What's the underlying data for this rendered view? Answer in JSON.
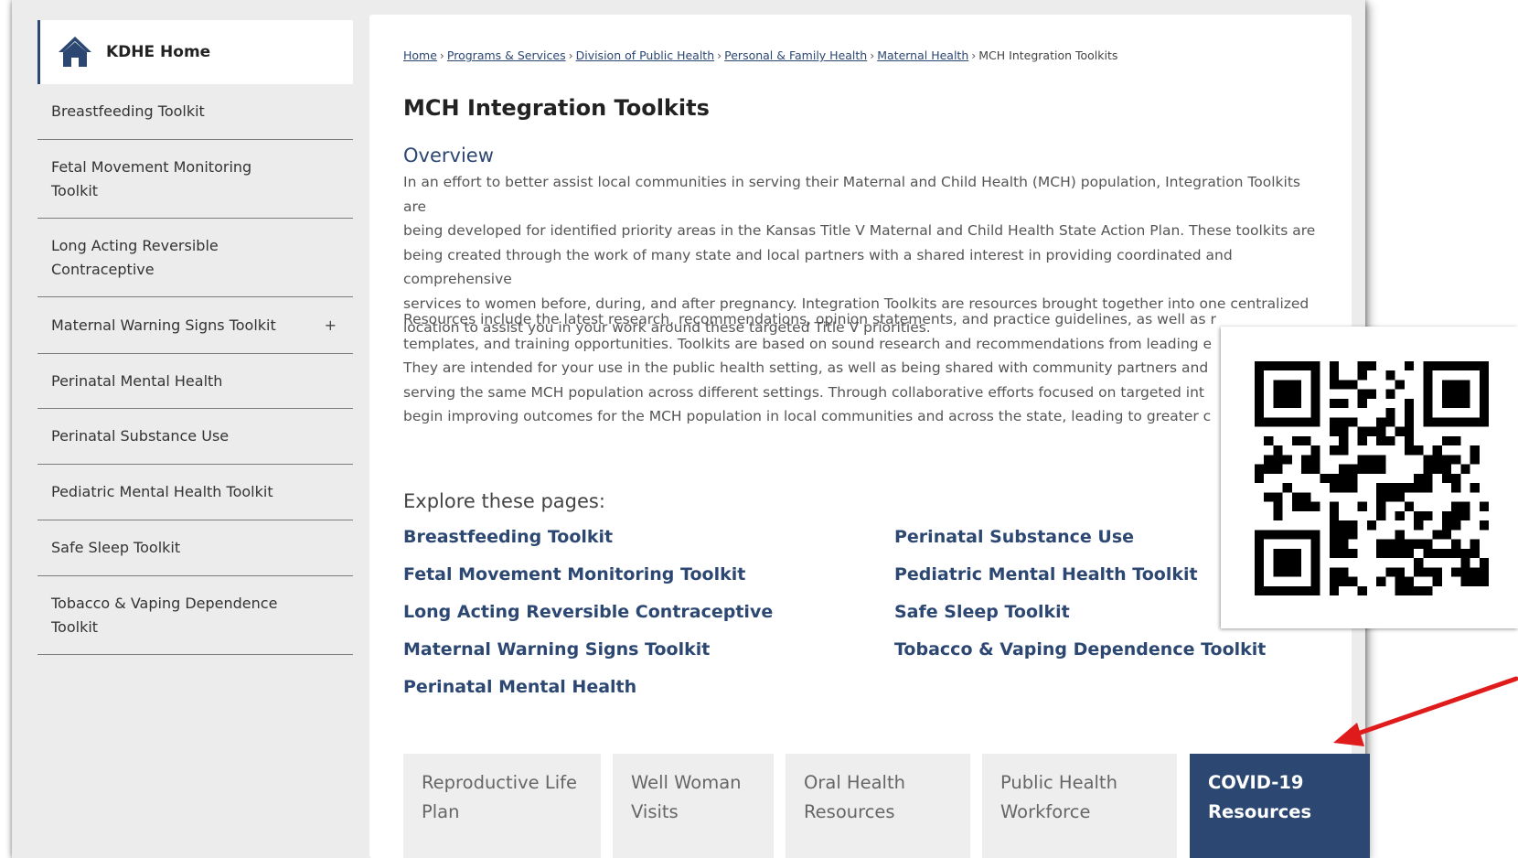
{
  "sidebar": {
    "home_label": "KDHE Home",
    "items": [
      {
        "label": "Breastfeeding Toolkit",
        "expand": ""
      },
      {
        "label": "Fetal Movement Monitoring Toolkit",
        "expand": ""
      },
      {
        "label": "Long Acting Reversible Contraceptive",
        "expand": ""
      },
      {
        "label": "Maternal Warning Signs Toolkit",
        "expand": "+"
      },
      {
        "label": "Perinatal Mental Health",
        "expand": ""
      },
      {
        "label": "Perinatal Substance Use",
        "expand": ""
      },
      {
        "label": "Pediatric Mental Health Toolkit",
        "expand": ""
      },
      {
        "label": "Safe Sleep Toolkit",
        "expand": ""
      },
      {
        "label": "Tobacco & Vaping Dependence Toolkit",
        "expand": ""
      }
    ]
  },
  "breadcrumb": {
    "links": [
      "Home",
      "Programs & Services",
      "Division of Public Health",
      "Personal & Family Health",
      "Maternal Health"
    ],
    "separator": "›",
    "current": "MCH Integration Toolkits"
  },
  "page": {
    "title": "MCH Integration Toolkits",
    "overview_heading": "Overview",
    "paragraph1_lines": [
      "In an effort to better assist local communities in serving their Maternal and Child Health (MCH) population, Integration Toolkits are",
      "being developed for identified priority areas in the Kansas Title V Maternal and Child Health State Action Plan. These toolkits are",
      "being created through the work of many state and local partners with a shared interest in providing coordinated and comprehensive",
      "services to women before, during, and after pregnancy. Integration Toolkits are resources brought together into one centralized",
      "location to assist you in your work around these targeted Title V priorities."
    ],
    "paragraph2_lines": [
      "Resources include the latest research, recommendations, opinion statements, and practice guidelines, as well as r",
      "templates, and training opportunities. Toolkits are based on sound research and recommendations from leading e",
      "They are intended for your use in the public health setting, as well as being shared with community partners and",
      "serving the same MCH population across different settings. Through collaborative efforts focused on targeted int",
      "begin improving outcomes for the MCH population in local communities and across the state, leading to greater c"
    ],
    "explore_heading": "Explore these pages:",
    "links_left": [
      "Breastfeeding Toolkit",
      "Fetal Movement Monitoring Toolkit",
      "Long Acting Reversible Contraceptive",
      "Maternal Warning Signs Toolkit",
      "Perinatal Mental Health"
    ],
    "links_right": [
      "Perinatal Substance Use",
      "Pediatric Mental Health Toolkit",
      "Safe Sleep Toolkit",
      "Tobacco & Vaping Dependence Toolkit"
    ]
  },
  "tiles": [
    {
      "line1": "Reproductive Life",
      "line2": "Plan"
    },
    {
      "line1": "Well Woman",
      "line2": "Visits"
    },
    {
      "line1": "Oral Health",
      "line2": "Resources"
    },
    {
      "line1": "Public Health",
      "line2": "Workforce"
    },
    {
      "line1": "COVID-19",
      "line2": "Resources"
    }
  ],
  "colors": {
    "brand_navy": "#2c4771",
    "arrow_red": "#e01b1b"
  },
  "icons": {
    "home": "house-icon",
    "qr": "qr-code-icon",
    "arrow": "red-arrow-icon"
  }
}
